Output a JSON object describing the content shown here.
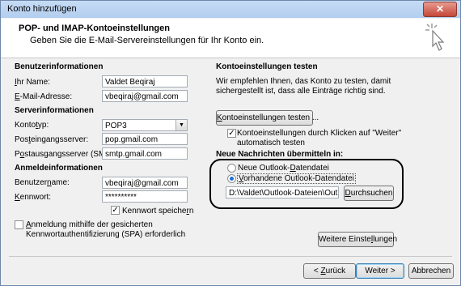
{
  "window": {
    "title": "Konto hinzufügen",
    "close_glyph": "✕"
  },
  "header": {
    "title": "POP- und IMAP-Kontoeinstellungen",
    "subtitle": "Geben Sie die E-Mail-Servereinstellungen für Ihr Konto ein.",
    "icon": "cursor-click-icon"
  },
  "left": {
    "user_info_heading": "Benutzerinformationen",
    "name_label_u": "I",
    "name_label_rest": "hr Name:",
    "name_value": "Valdet Beqiraj",
    "email_label_u": "E",
    "email_label_rest": "-Mail-Adresse:",
    "email_value": "vbeqiraj@gmail.com",
    "server_heading": "Serverinformationen",
    "type_label_pre": "Konto",
    "type_label_u": "t",
    "type_label_post": "yp:",
    "type_value": "POP3",
    "incoming_label_pre": "Pos",
    "incoming_label_u": "t",
    "incoming_label_post": "eingangsserver:",
    "incoming_value": "pop.gmail.com",
    "outgoing_label_pre": "P",
    "outgoing_label_u": "o",
    "outgoing_label_post": "stausgangsserver (SMTP):",
    "outgoing_value": "smtp.gmail.com",
    "login_heading": "Anmeldeinformationen",
    "username_label_pre": "Benutzer",
    "username_label_u": "n",
    "username_label_post": "ame:",
    "username_value": "vbeqiraj@gmail.com",
    "password_label_u": "K",
    "password_label_rest": "ennwort:",
    "password_value": "**********",
    "remember_pre": "Kennwort speiche",
    "remember_u": "r",
    "remember_post": "n",
    "remember_checked": "✓",
    "spa_line1_u": "A",
    "spa_line1_rest": "nmeldung mithilfe der gesicherten",
    "spa_line2": "Kennwortauthentifizierung (SPA) erforderlich"
  },
  "right": {
    "test_heading": "Kontoeinstellungen testen",
    "test_desc1": "Wir empfehlen Ihnen, das Konto zu testen, damit",
    "test_desc2": "sichergestellt ist, dass alle Einträge richtig sind.",
    "test_button_u": "K",
    "test_button_rest": "ontoeinstellungen testen ...",
    "auto_test_line1": "Kontoeinstellungen durch Klicken auf \"Weiter\"",
    "auto_test_line2": "automatisch testen",
    "auto_test_checked": "✓",
    "deliver_heading": "Neue Nachrichten übermitteln in:",
    "new_file_pre": "Neue Outlook-",
    "new_file_u": "D",
    "new_file_post": "atendatei",
    "existing_u": "V",
    "existing_rest": "orhandene Outlook-Datendatei",
    "existing_path": "D:\\Valdet\\Outlook-Dateien\\Outlook",
    "browse_u": "D",
    "browse_rest": "urchsuchen",
    "more_settings_pre": "Weitere Einste",
    "more_settings_u": "l",
    "more_settings_post": "lungen"
  },
  "footer": {
    "back_pre": "< ",
    "back_u": "Z",
    "back_post": "urück",
    "next_label": "Weiter >",
    "cancel_label": "Abbrechen"
  }
}
